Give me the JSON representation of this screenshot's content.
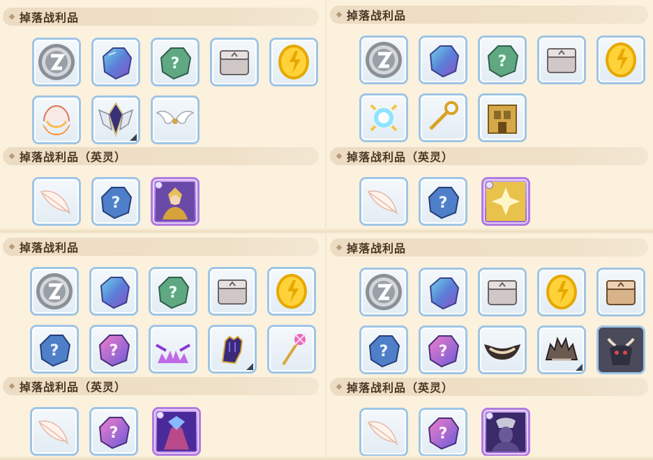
{
  "labels": {
    "drops": "掉落战利品",
    "drops_heroic": "掉落战利品（英灵）"
  },
  "colors": {
    "panel_bg": "#fbf1dc",
    "header_bg": "#ecdcc3",
    "slot_border": "#9ec5e6",
    "slot_border_rare": "#b07be0"
  },
  "panels": [
    {
      "id": "top-left",
      "drops": [
        "silver-coin-icon",
        "blue-crystal-icon",
        "green-mystery-gem-icon",
        "treasure-chest-icon",
        "gold-coin-icon",
        "fire-egg-icon",
        "winged-crest-icon",
        "white-wings-icon"
      ],
      "heroic": [
        "feather-icon",
        "blue-mystery-gem-icon",
        "golden-knight-card-icon"
      ]
    },
    {
      "id": "top-right",
      "drops": [
        "silver-coin-icon",
        "blue-crystal-icon",
        "green-mystery-gem-icon",
        "treasure-chest-icon",
        "gold-coin-icon",
        "blue-spark-orb-icon",
        "golden-key-icon",
        "golden-fortress-icon"
      ],
      "heroic": [
        "feather-icon",
        "blue-mystery-gem-icon",
        "golden-cross-card-icon"
      ]
    },
    {
      "id": "bottom-left",
      "drops": [
        "silver-coin-icon",
        "blue-crystal-icon",
        "green-mystery-gem-icon",
        "treasure-chest-icon",
        "gold-coin-icon",
        "blue-mystery-gem-icon",
        "pink-mystery-gem-icon",
        "purple-flame-mask-icon",
        "dark-gauntlet-icon",
        "pink-magic-staff-icon"
      ],
      "heroic": [
        "feather-icon",
        "pink-mystery-gem-icon",
        "purple-warrior-card-icon"
      ]
    },
    {
      "id": "bottom-right",
      "drops": [
        "silver-coin-icon",
        "blue-crystal-icon",
        "treasure-chest-icon",
        "gold-coin-icon",
        "brown-chest-icon",
        "blue-mystery-gem-icon",
        "pink-mystery-gem-icon",
        "horned-mask-icon",
        "spiked-helmet-icon",
        "dark-dragon-icon"
      ],
      "heroic": [
        "feather-icon",
        "pink-mystery-gem-icon",
        "shadow-knight-card-icon"
      ]
    }
  ]
}
